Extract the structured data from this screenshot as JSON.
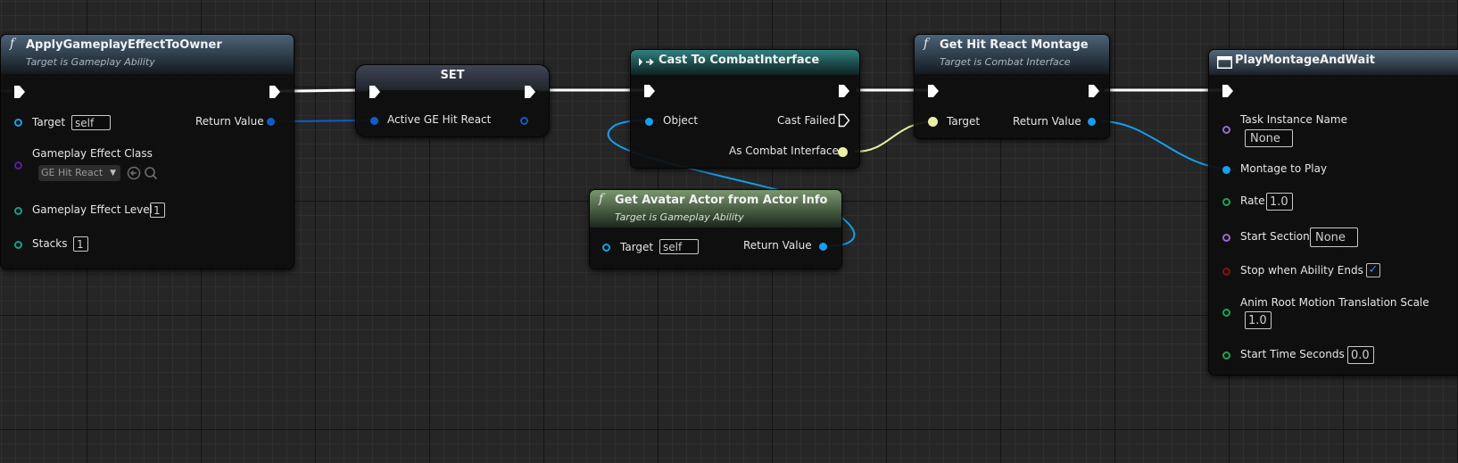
{
  "nodes": {
    "apply": {
      "title": "ApplyGameplayEffectToOwner",
      "subtitle": "Target is Gameplay Ability",
      "icon": "function-icon",
      "pins": {
        "target": "Target",
        "target_value": "self",
        "return_value": "Return Value",
        "effect_class": "Gameplay Effect Class",
        "effect_class_value": "GE Hit React",
        "effect_level": "Gameplay Effect Level",
        "effect_level_value": "1",
        "stacks": "Stacks",
        "stacks_value": "1"
      }
    },
    "set": {
      "title": "SET",
      "pins": {
        "var": "Active GE Hit React"
      }
    },
    "cast": {
      "title": "Cast To CombatInterface",
      "icon": "cast-arrows-icon",
      "pins": {
        "object": "Object",
        "cast_failed": "Cast Failed",
        "as_combat": "As Combat Interface"
      }
    },
    "hitreact": {
      "title": "Get Hit React Montage",
      "subtitle": "Target is Combat Interface",
      "icon": "function-icon",
      "pins": {
        "target": "Target",
        "return_value": "Return Value"
      }
    },
    "avatar": {
      "title": "Get Avatar Actor from Actor Info",
      "subtitle": "Target is Gameplay Ability",
      "icon": "function-icon",
      "pins": {
        "target": "Target",
        "target_value": "self",
        "return_value": "Return Value"
      }
    },
    "montage": {
      "title": "PlayMontageAndWait",
      "icon": "task-icon",
      "pins": {
        "task_name": "Task Instance Name",
        "task_name_value": "None",
        "montage": "Montage to Play",
        "rate": "Rate",
        "rate_value": "1.0",
        "start_section": "Start Section",
        "start_section_value": "None",
        "stop_when_ends": "Stop when Ability Ends",
        "stop_when_ends_checked": true,
        "root_motion": "Anim Root Motion Translation Scale",
        "root_motion_value": "1.0",
        "start_time": "Start Time Seconds",
        "start_time_value": "0.0"
      }
    }
  },
  "colors": {
    "exec_wire": "#ffffff",
    "object_wire": "#14a0f0",
    "struct_wire": "#0e5ec8",
    "interface_wire": "#e9f0a3"
  }
}
